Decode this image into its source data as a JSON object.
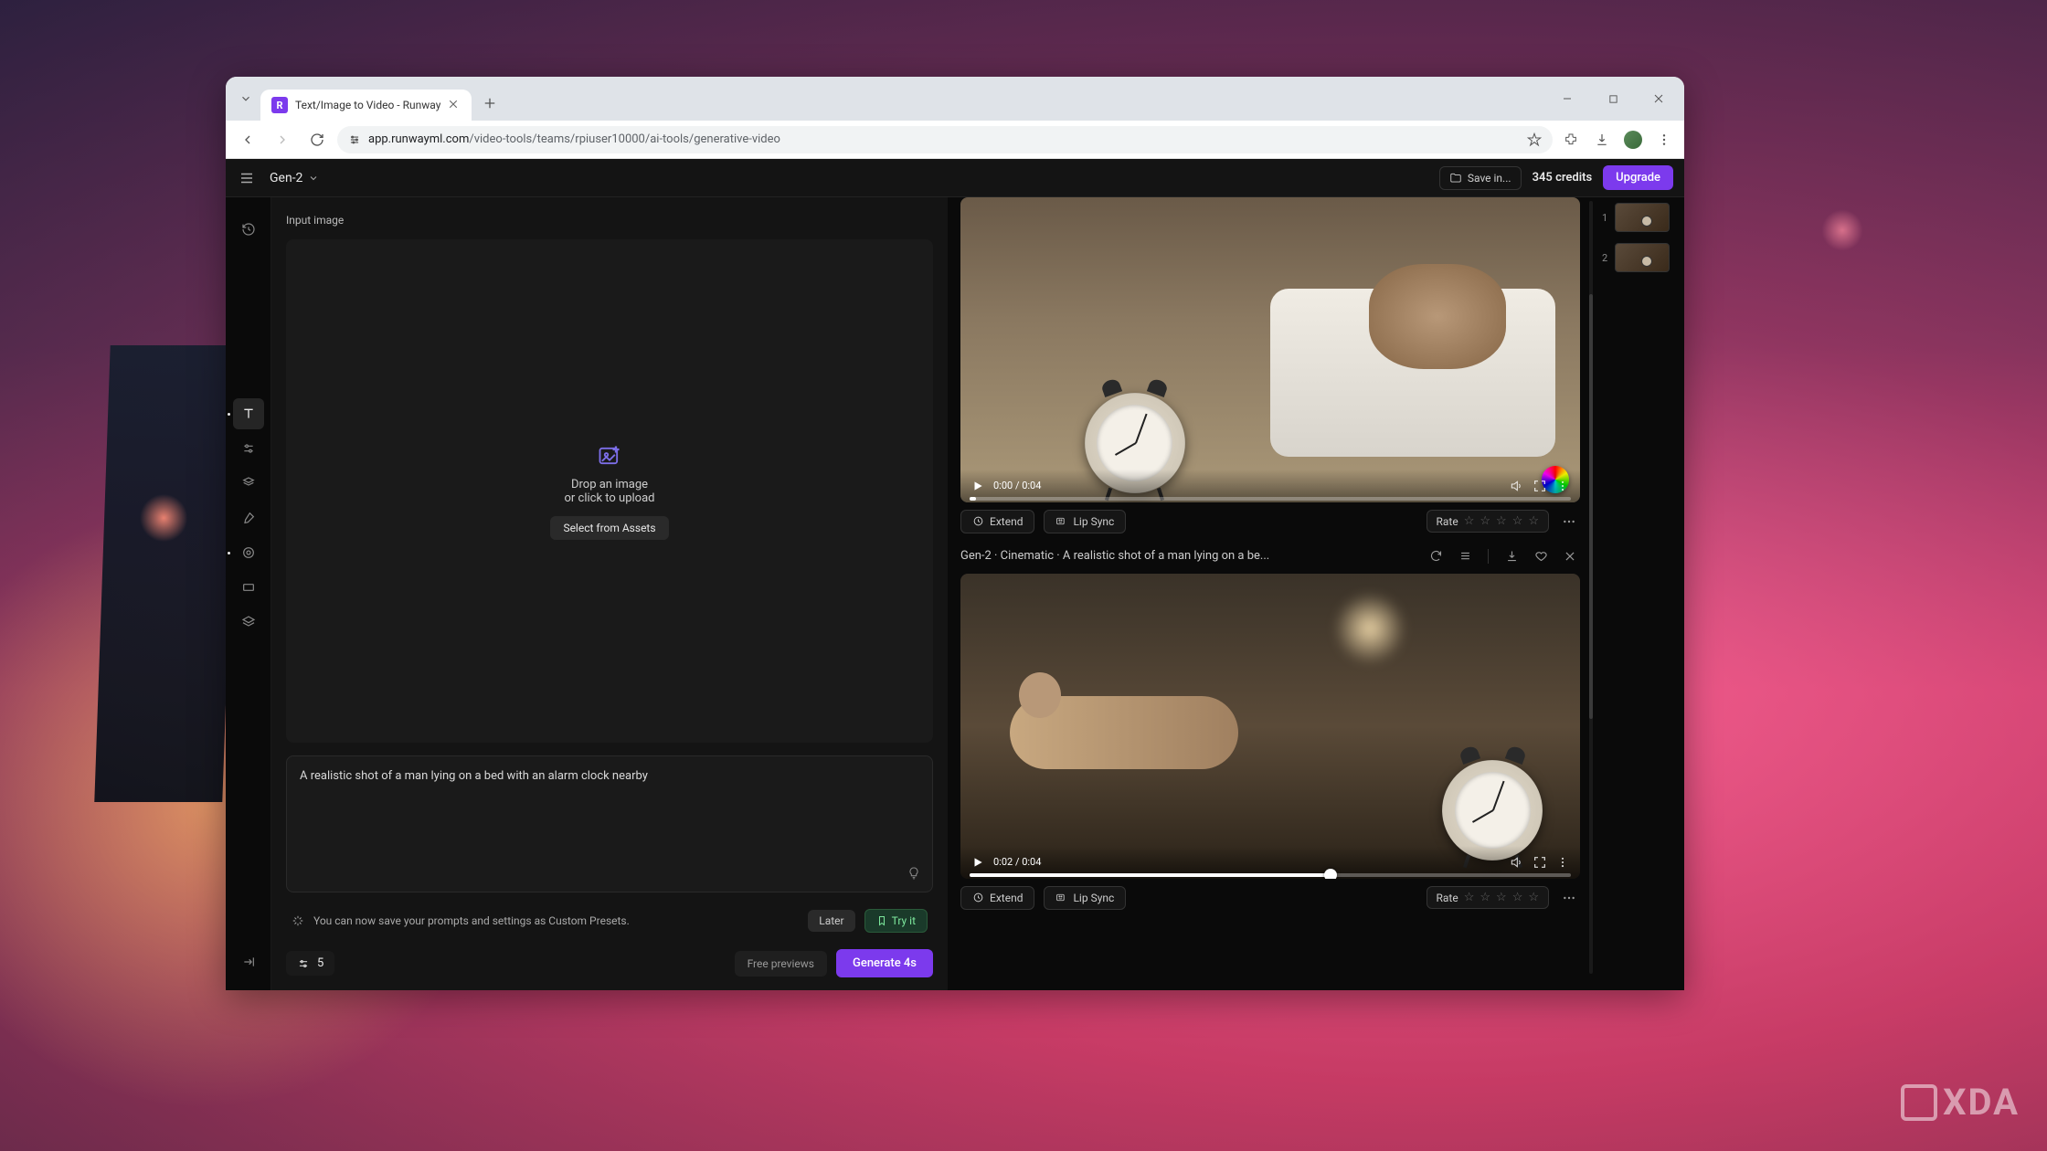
{
  "browser": {
    "tab_title": "Text/Image to Video - Runway",
    "url_host": "app.runwayml.com",
    "url_path": "/video-tools/teams/rpiuser10000/ai-tools/generative-video"
  },
  "header": {
    "model": "Gen-2",
    "save_label": "Save in...",
    "credits": "345 credits",
    "upgrade_label": "Upgrade"
  },
  "left": {
    "section_label": "Input image",
    "drop_line1": "Drop an image",
    "drop_line2": "or click to upload",
    "select_assets": "Select from Assets",
    "prompt_value": "A realistic shot of a man lying on a bed with an alarm clock nearby",
    "tip_text": "You can now save your prompts and settings as Custom Presets.",
    "later_label": "Later",
    "tryit_label": "Try it",
    "count_value": "5",
    "free_previews": "Free previews",
    "generate_label": "Generate 4s"
  },
  "results": {
    "item2_title": "Gen-2 · Cinematic · A realistic shot of a man lying on a be...",
    "video1_time": "0:00 / 0:04",
    "video2_time": "0:02 / 0:04",
    "extend_label": "Extend",
    "lipsync_label": "Lip Sync",
    "rate_label": "Rate"
  },
  "thumbs": {
    "n1": "1",
    "n2": "2"
  },
  "watermark": "XDA"
}
